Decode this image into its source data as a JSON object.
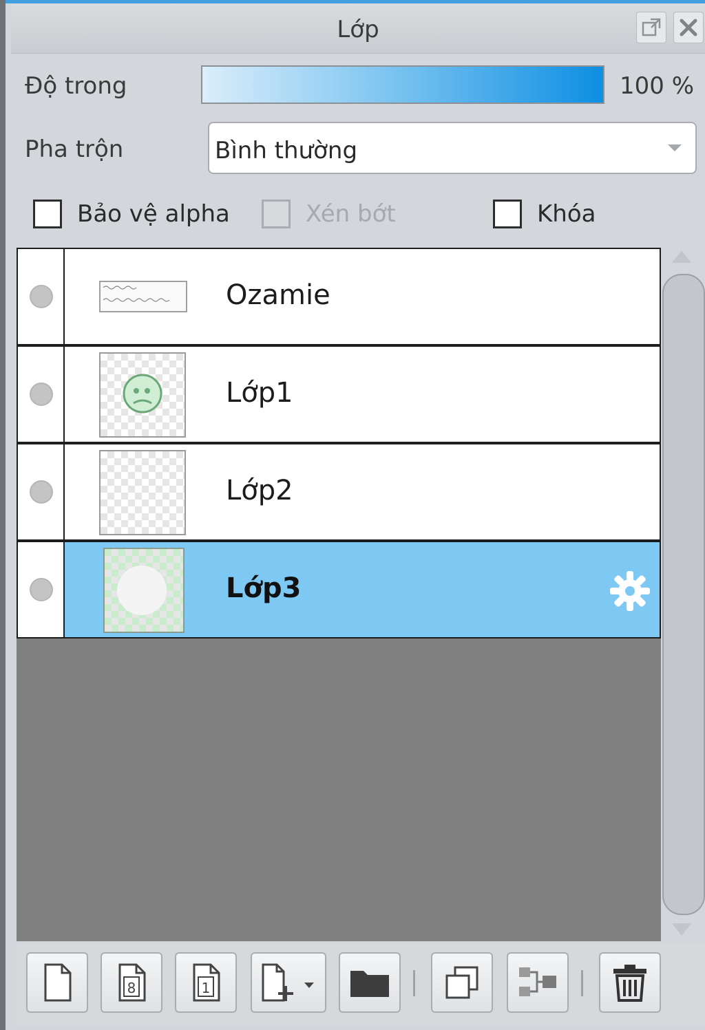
{
  "panel": {
    "title": "Lớp",
    "float_icon": "popout-icon",
    "close_icon": "close-icon"
  },
  "opacity": {
    "label": "Độ trong",
    "value_text": "100 %",
    "value_fraction": 1.0
  },
  "blend": {
    "label": "Pha trộn",
    "selected": "Bình thường"
  },
  "options": {
    "protect_alpha": {
      "label": "Bảo vệ alpha",
      "checked": false,
      "enabled": true
    },
    "clipping": {
      "label": "Xén bớt",
      "checked": false,
      "enabled": false
    },
    "lock": {
      "label": "Khóa",
      "checked": false,
      "enabled": true
    }
  },
  "layers": [
    {
      "name": "Ozamie",
      "thumb": "text",
      "selected": false
    },
    {
      "name": "Lớp1",
      "thumb": "face",
      "selected": false
    },
    {
      "name": "Lớp2",
      "thumb": "empty",
      "selected": false
    },
    {
      "name": "Lớp3",
      "thumb": "green-circle",
      "selected": true
    }
  ],
  "toolbar": {
    "buttons": [
      "new-layer-icon",
      "new-8bit-layer-icon",
      "new-1bit-layer-icon",
      "add-layer-dropdown-icon",
      "new-folder-icon",
      "duplicate-layer-icon",
      "merge-down-icon",
      "delete-layer-icon"
    ]
  },
  "colors": {
    "accent": "#3f9fdf",
    "selected_row": "#7ec9f4",
    "list_background": "#808080"
  }
}
